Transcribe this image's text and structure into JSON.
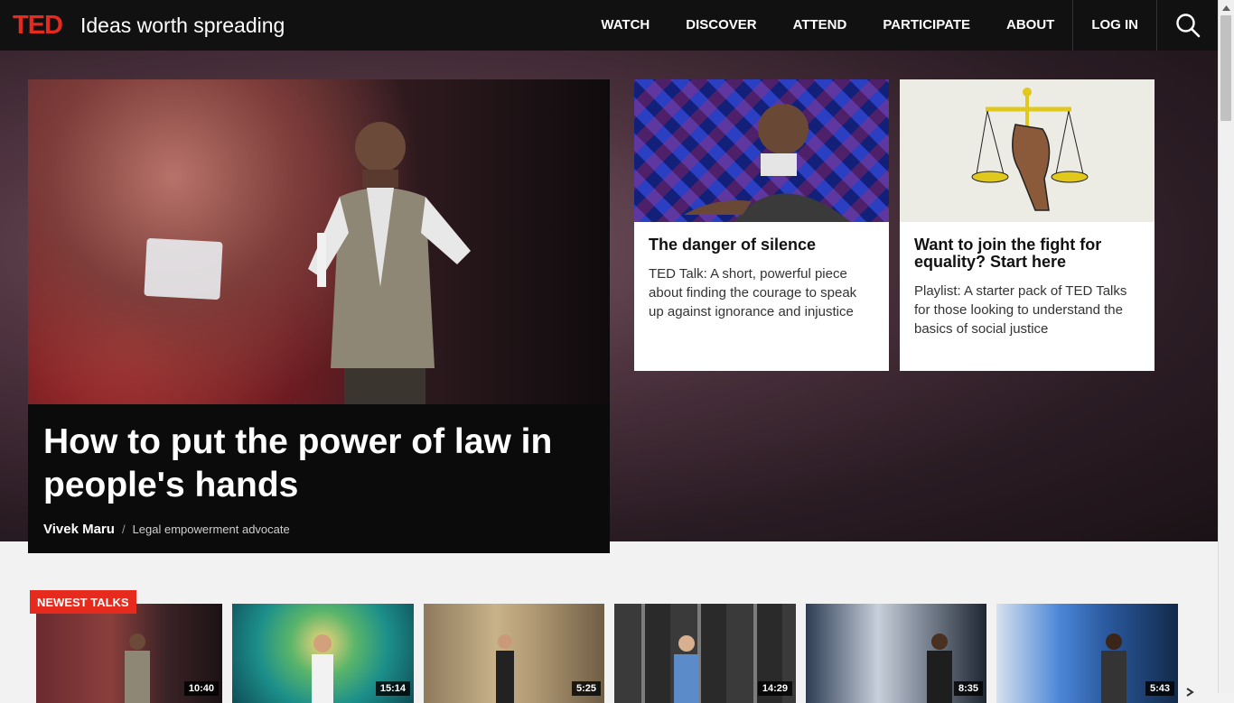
{
  "nav": {
    "logo": "TED",
    "tagline": "Ideas worth spreading",
    "links": [
      "WATCH",
      "DISCOVER",
      "ATTEND",
      "PARTICIPATE",
      "ABOUT"
    ],
    "login": "LOG IN",
    "search_icon": "search-icon"
  },
  "feature": {
    "title": "How to put the power of law in people's hands",
    "speaker": "Vivek Maru",
    "separator": "/",
    "role": "Legal empowerment advocate"
  },
  "cards": [
    {
      "title": "The danger of silence",
      "description": "TED Talk: A short, powerful piece about finding the courage to speak up against ignorance and injustice"
    },
    {
      "title": "Want to join the fight for equality? Start here",
      "description": "Playlist: A starter pack of TED Talks for those looking to understand the basics of social justice"
    }
  ],
  "newest": {
    "label": "NEWEST TALKS",
    "durations": [
      "10:40",
      "15:14",
      "5:25",
      "14:29",
      "8:35",
      "5:43"
    ]
  },
  "colors": {
    "brand_red": "#e62b1e",
    "nav_bg": "#111111",
    "hero_bg": "#3a2630"
  }
}
